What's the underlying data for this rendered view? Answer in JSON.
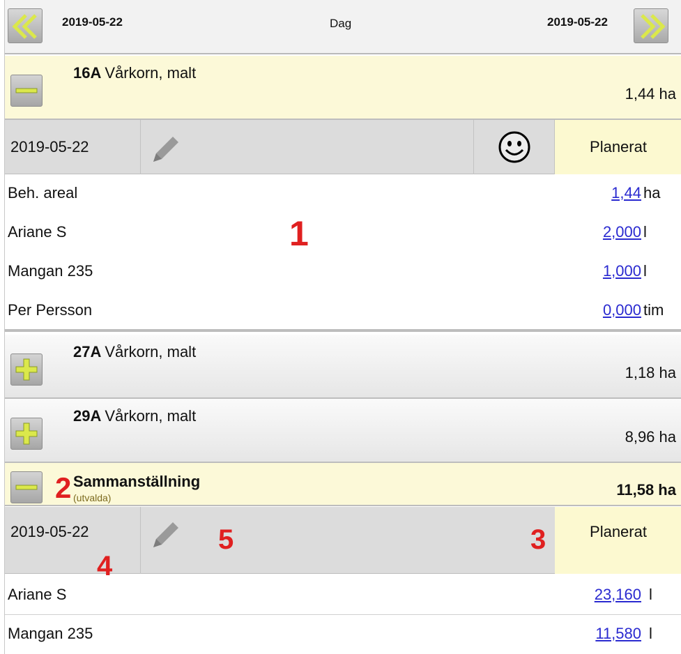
{
  "nav": {
    "date_from": "2019-05-22",
    "mode": "Dag",
    "date_to": "2019-05-22"
  },
  "groups": [
    {
      "id": "16A",
      "crop": "Vårkorn, malt",
      "area": "1,44 ha",
      "expanded": true
    },
    {
      "id": "27A",
      "crop": "Vårkorn, malt",
      "area": "1,18 ha",
      "expanded": false
    },
    {
      "id": "29A",
      "crop": "Vårkorn, malt",
      "area": "8,96 ha",
      "expanded": false
    }
  ],
  "detail": {
    "date": "2019-05-22",
    "status": "Planerat",
    "rows": [
      {
        "label": "Beh. areal",
        "value": "1,44",
        "unit": "ha"
      },
      {
        "label": "Ariane S",
        "value": "2,000",
        "unit": "l"
      },
      {
        "label": "Mangan 235",
        "value": "1,000",
        "unit": "l"
      },
      {
        "label": "Per Persson",
        "value": "0,000",
        "unit": "tim"
      }
    ]
  },
  "summary": {
    "title": "Sammanställning",
    "subtitle": "(utvalda)",
    "area": "11,58 ha",
    "date": "2019-05-22",
    "status": "Planerat",
    "rows": [
      {
        "label": "Ariane S",
        "value": "23,160",
        "unit": "l"
      },
      {
        "label": "Mangan 235",
        "value": "11,580",
        "unit": "l"
      }
    ]
  },
  "annotations": [
    "1",
    "2",
    "3",
    "4",
    "5"
  ],
  "colors": {
    "open_header": "#fcf9d8",
    "status_cell": "#fcf9d0",
    "link": "#2a2ad0",
    "annotation": "#e02020",
    "icon_green": "#d9e84a"
  }
}
